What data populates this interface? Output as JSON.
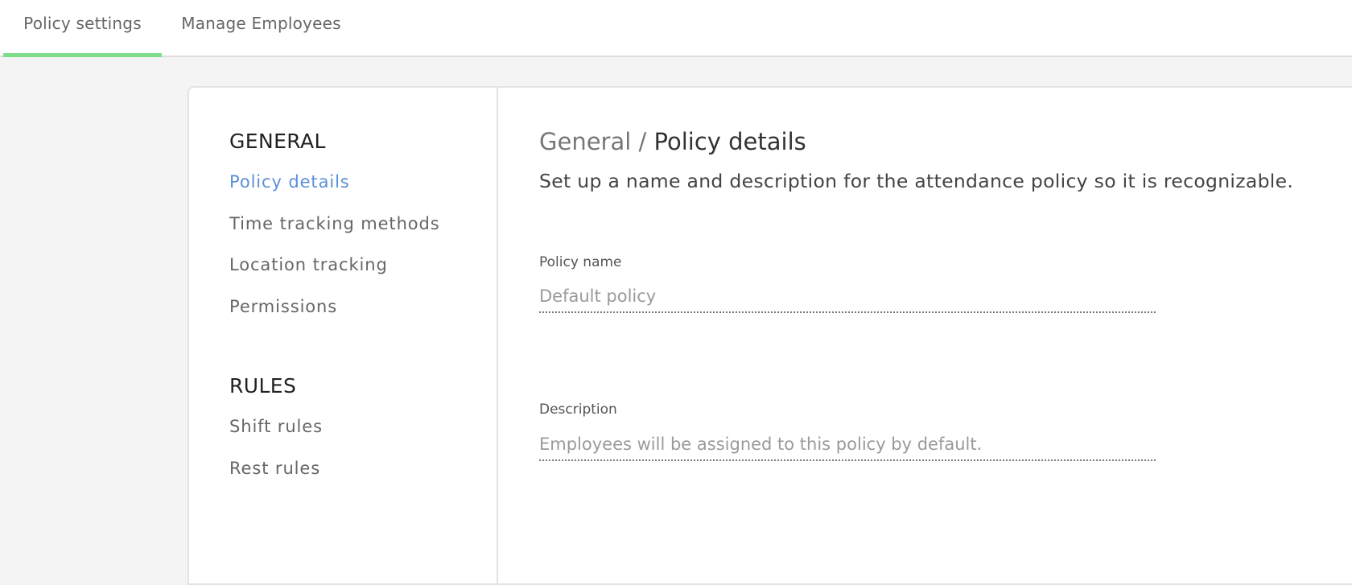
{
  "tabs": [
    {
      "label": "Policy settings",
      "active": true
    },
    {
      "label": "Manage Employees",
      "active": false
    }
  ],
  "colors": {
    "accent_green": "#7ddd8a",
    "active_link": "#5b8fd8"
  },
  "sidebar": {
    "sections": [
      {
        "heading": "GENERAL",
        "items": [
          {
            "label": "Policy details",
            "active": true
          },
          {
            "label": "Time tracking methods",
            "active": false
          },
          {
            "label": "Location tracking",
            "active": false
          },
          {
            "label": "Permissions",
            "active": false
          }
        ]
      },
      {
        "heading": "RULES",
        "items": [
          {
            "label": "Shift rules",
            "active": false
          },
          {
            "label": "Rest rules",
            "active": false
          }
        ]
      }
    ]
  },
  "main": {
    "breadcrumb": {
      "parent": "General",
      "separator": " / ",
      "current": "Policy details"
    },
    "subtitle": "Set up a name and description for the attendance policy so it is recognizable.",
    "fields": {
      "policy_name": {
        "label": "Policy name",
        "placeholder": "Default policy",
        "value": ""
      },
      "description": {
        "label": "Description",
        "placeholder": "Employees will be assigned to this policy by default.",
        "value": ""
      }
    }
  }
}
